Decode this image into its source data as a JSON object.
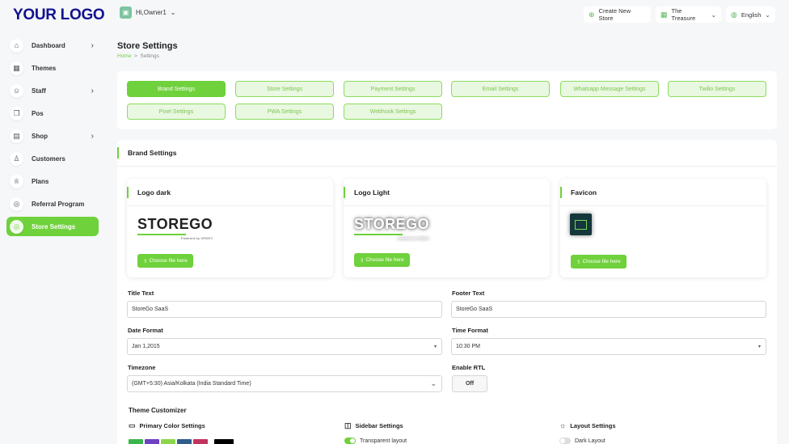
{
  "brand": {
    "logo_text": "YOUR LOGO"
  },
  "sidebar": {
    "items": [
      {
        "label": "Dashboard",
        "icon": "home-icon",
        "glyph": "⌂",
        "chevron": "›"
      },
      {
        "label": "Themes",
        "icon": "grid-icon",
        "glyph": "▦",
        "chevron": ""
      },
      {
        "label": "Staff",
        "icon": "users-icon",
        "glyph": "☺",
        "chevron": "›"
      },
      {
        "label": "Pos",
        "icon": "copy-icon",
        "glyph": "❐",
        "chevron": ""
      },
      {
        "label": "Shop",
        "icon": "shop-icon",
        "glyph": "▤",
        "chevron": "›"
      },
      {
        "label": "Customers",
        "icon": "user-icon",
        "glyph": "♙",
        "chevron": ""
      },
      {
        "label": "Plans",
        "icon": "trophy-icon",
        "glyph": "♕",
        "chevron": ""
      },
      {
        "label": "Referral Program",
        "icon": "referral-icon",
        "glyph": "◎",
        "chevron": ""
      },
      {
        "label": "Store Settings",
        "icon": "settings-icon",
        "glyph": "◎",
        "chevron": ""
      }
    ]
  },
  "header": {
    "owner": "Hi,Owner1",
    "owner_caret": "⌄",
    "create_store": "Create New Store",
    "create_glyph": "⊕",
    "store": "The Treasure",
    "store_glyph": "▦",
    "store_caret": "⌄",
    "language": "English",
    "language_glyph": "◍",
    "language_caret": "⌄"
  },
  "page": {
    "title": "Store Settings",
    "crumb_home": "Home",
    "crumb_sep": ">",
    "crumb_current": "Settings"
  },
  "tabs": [
    "Brand Settings",
    "Store Settings",
    "Payment Settings",
    "Email Settings",
    "Whatsapp Message Settings",
    "Twilio Settings",
    "Pixel Settings",
    "PWA Settings",
    "Webhook Settings"
  ],
  "brand_settings": {
    "title": "Brand Settings",
    "logo_dark": {
      "title": "Logo dark",
      "text": "STOREGO",
      "powered": "Powered by VRDEV",
      "button": "Choose file here",
      "btn_glyph": "⇧"
    },
    "logo_light": {
      "title": "Logo Light",
      "text": "STOREGO",
      "powered": "Powered by VRDEV",
      "button": "Choose file here",
      "btn_glyph": "⇧"
    },
    "favicon": {
      "title": "Favicon",
      "button": "Choose file here",
      "btn_glyph": "⇧"
    }
  },
  "form": {
    "title_text_label": "Title Text",
    "title_text_value": "StoreGo SaaS",
    "footer_text_label": "Footer Text",
    "footer_text_value": "StoreGo SaaS",
    "date_format_label": "Date Format",
    "date_format_value": "Jan 1,2015",
    "time_format_label": "Time Format",
    "time_format_value": "10:30 PM",
    "timezone_label": "Timezone",
    "timezone_value": "(GMT+5:30) Asia/Kolkata (India Standard Time)",
    "rtl_label": "Enable RTL",
    "rtl_value": "Off",
    "caret": "▾",
    "chevron": "⌄"
  },
  "theme": {
    "title": "Theme Customizer",
    "primary_color": "Primary Color Settings",
    "primary_glyph": "▭",
    "sidebar": "Sidebar Settings",
    "sidebar_glyph": "◫",
    "layout": "Layout Settings",
    "layout_glyph": "☼",
    "transparent_layout": "Transparent layout",
    "dark_layout": "Dark Layout",
    "swatches": [
      "#3bb54a",
      "#6f42c1",
      "#8cd64b",
      "#2f5d8c",
      "#c2335f",
      "#ffffff",
      "#000000"
    ]
  },
  "colors": {
    "accent": "#6fd13b",
    "logo": "#12128f"
  }
}
